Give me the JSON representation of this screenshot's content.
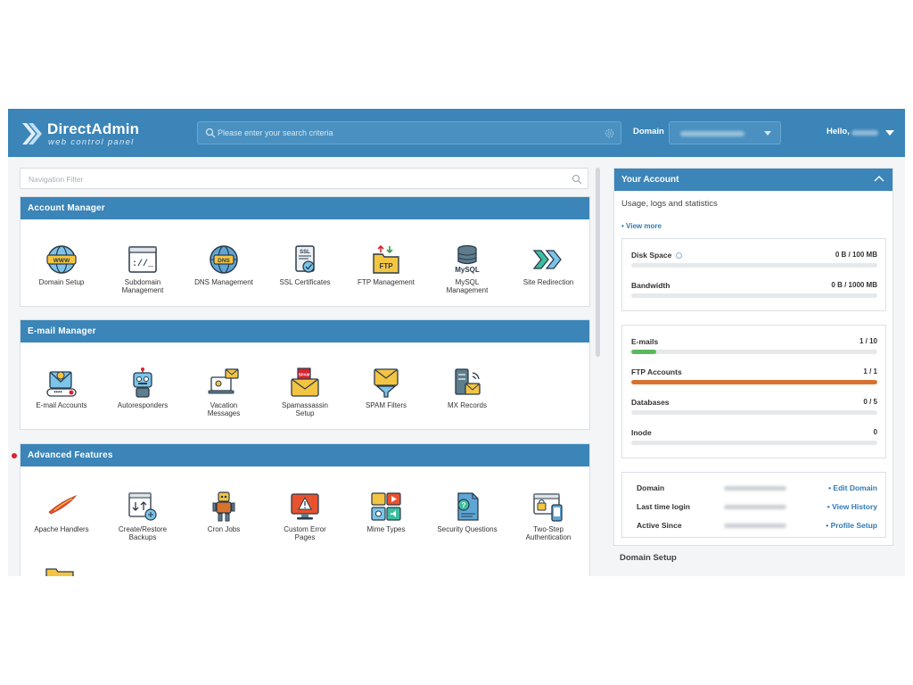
{
  "header": {
    "logo_name": "DirectAdmin",
    "logo_sub": "web control panel",
    "search_placeholder": "Please enter your search criteria",
    "domain_label": "Domain",
    "hello_label": "Hello,"
  },
  "nav_filter": {
    "placeholder": "Navigation Filter"
  },
  "sections": {
    "account_manager": {
      "title": "Account Manager",
      "items": [
        {
          "label": "Domain Setup",
          "icon": "www-globe-icon"
        },
        {
          "label": "Subdomain\nManagement",
          "icon": "terminal-window-icon"
        },
        {
          "label": "DNS Management",
          "icon": "dns-globe-icon"
        },
        {
          "label": "SSL Certificates",
          "icon": "ssl-certificate-icon"
        },
        {
          "label": "FTP Management",
          "icon": "ftp-folder-icon"
        },
        {
          "label": "MySQL\nManagement",
          "icon": "mysql-database-icon"
        },
        {
          "label": "Site Redirection",
          "icon": "redirect-arrows-icon"
        }
      ]
    },
    "email_manager": {
      "title": "E-mail Manager",
      "items": [
        {
          "label": "E-mail Accounts",
          "icon": "email-account-icon"
        },
        {
          "label": "Autoresponders",
          "icon": "robot-icon"
        },
        {
          "label": "Vacation\nMessages",
          "icon": "vacation-laptop-icon"
        },
        {
          "label": "Spamassassin\nSetup",
          "icon": "spam-envelope-icon"
        },
        {
          "label": "SPAM Filters",
          "icon": "spam-filter-icon"
        },
        {
          "label": "MX Records",
          "icon": "mx-server-icon"
        }
      ]
    },
    "advanced_features": {
      "title": "Advanced Features",
      "items": [
        {
          "label": "Apache Handlers",
          "icon": "apache-feather-icon"
        },
        {
          "label": "Create/Restore\nBackups",
          "icon": "backup-icon"
        },
        {
          "label": "Cron Jobs",
          "icon": "cron-robot-icon"
        },
        {
          "label": "Custom Error\nPages",
          "icon": "error-monitor-icon"
        },
        {
          "label": "Mime Types",
          "icon": "mime-types-icon"
        },
        {
          "label": "Security Questions",
          "icon": "security-document-icon"
        },
        {
          "label": "Two-Step\nAuthentication",
          "icon": "two-step-auth-icon"
        }
      ]
    }
  },
  "account": {
    "title": "Your Account",
    "subtitle": "Usage, logs and statistics",
    "view_more": "• View more",
    "usage": [
      {
        "label": "Disk Space",
        "value": "0 B / 100 MB",
        "fraction": 0
      },
      {
        "label": "Bandwidth",
        "value": "0 B / 1000 MB",
        "fraction": 0
      }
    ],
    "limits": [
      {
        "label": "E-mails",
        "value": "1 / 10",
        "fraction": 0.1,
        "color": "#5cb85c"
      },
      {
        "label": "FTP Accounts",
        "value": "1 / 1",
        "fraction": 1.0,
        "color": "#d9722e"
      },
      {
        "label": "Databases",
        "value": "0 / 5",
        "fraction": 0,
        "color": "#5cb85c"
      },
      {
        "label": "Inode",
        "value": "0",
        "fraction": 0,
        "color": "#5cb85c"
      }
    ],
    "info": [
      {
        "key": "Domain",
        "action": "• Edit Domain"
      },
      {
        "key": "Last time login",
        "action": "• View History"
      },
      {
        "key": "Active Since",
        "action": "• Profile Setup"
      }
    ],
    "next_section": "Domain Setup"
  },
  "colors": {
    "header": "#3b85b8",
    "link": "#2f7bb6",
    "email_bar": "#5cb85c",
    "ftp_bar": "#d9722e"
  }
}
